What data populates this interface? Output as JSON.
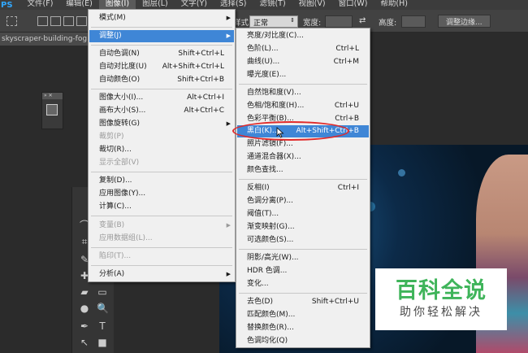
{
  "menubar": {
    "logo": "PS",
    "items": [
      "文件(F)",
      "编辑(E)",
      "图像(I)",
      "图层(L)",
      "文字(Y)",
      "选择(S)",
      "滤镜(T)",
      "视图(V)",
      "窗口(W)",
      "帮助(H)"
    ],
    "active_index": 2
  },
  "options": {
    "style_label": "样式:",
    "style_value": "正常",
    "width_label": "宽度:",
    "height_label": "高度:",
    "refine_button": "调整边缘..."
  },
  "document": {
    "tab_title": "skyscraper-building-fog.jp"
  },
  "image_menu": {
    "items": [
      {
        "label": "模式(M)",
        "shortcut": "",
        "submenu": true,
        "disabled": false,
        "highlighted": false
      },
      {
        "label": "调整(J)",
        "shortcut": "",
        "submenu": true,
        "disabled": false,
        "highlighted": true
      },
      {
        "label": "自动色调(N)",
        "shortcut": "Shift+Ctrl+L",
        "submenu": false,
        "disabled": false,
        "highlighted": false
      },
      {
        "label": "自动对比度(U)",
        "shortcut": "Alt+Shift+Ctrl+L",
        "submenu": false,
        "disabled": false,
        "highlighted": false
      },
      {
        "label": "自动颜色(O)",
        "shortcut": "Shift+Ctrl+B",
        "submenu": false,
        "disabled": false,
        "highlighted": false
      },
      {
        "label": "图像大小(I)...",
        "shortcut": "Alt+Ctrl+I",
        "submenu": false,
        "disabled": false,
        "highlighted": false
      },
      {
        "label": "画布大小(S)...",
        "shortcut": "Alt+Ctrl+C",
        "submenu": false,
        "disabled": false,
        "highlighted": false
      },
      {
        "label": "图像旋转(G)",
        "shortcut": "",
        "submenu": true,
        "disabled": false,
        "highlighted": false
      },
      {
        "label": "裁剪(P)",
        "shortcut": "",
        "submenu": false,
        "disabled": true,
        "highlighted": false
      },
      {
        "label": "裁切(R)...",
        "shortcut": "",
        "submenu": false,
        "disabled": false,
        "highlighted": false
      },
      {
        "label": "显示全部(V)",
        "shortcut": "",
        "submenu": false,
        "disabled": true,
        "highlighted": false
      },
      {
        "label": "复制(D)...",
        "shortcut": "",
        "submenu": false,
        "disabled": false,
        "highlighted": false
      },
      {
        "label": "应用图像(Y)...",
        "shortcut": "",
        "submenu": false,
        "disabled": false,
        "highlighted": false
      },
      {
        "label": "计算(C)...",
        "shortcut": "",
        "submenu": false,
        "disabled": false,
        "highlighted": false
      },
      {
        "label": "变量(B)",
        "shortcut": "",
        "submenu": true,
        "disabled": true,
        "highlighted": false
      },
      {
        "label": "应用数据组(L)...",
        "shortcut": "",
        "submenu": false,
        "disabled": true,
        "highlighted": false
      },
      {
        "label": "陷印(T)...",
        "shortcut": "",
        "submenu": false,
        "disabled": true,
        "highlighted": false
      },
      {
        "label": "分析(A)",
        "shortcut": "",
        "submenu": true,
        "disabled": false,
        "highlighted": false
      }
    ]
  },
  "adjust_menu": {
    "items": [
      {
        "label": "亮度/对比度(C)...",
        "shortcut": "",
        "highlighted": false
      },
      {
        "label": "色阶(L)...",
        "shortcut": "Ctrl+L",
        "highlighted": false
      },
      {
        "label": "曲线(U)...",
        "shortcut": "Ctrl+M",
        "highlighted": false
      },
      {
        "label": "曝光度(E)...",
        "shortcut": "",
        "highlighted": false
      },
      {
        "label": "自然饱和度(V)...",
        "shortcut": "",
        "highlighted": false
      },
      {
        "label": "色相/饱和度(H)...",
        "shortcut": "Ctrl+U",
        "highlighted": false
      },
      {
        "label": "色彩平衡(B)...",
        "shortcut": "Ctrl+B",
        "highlighted": false
      },
      {
        "label": "黑白(K)...",
        "shortcut": "Alt+Shift+Ctrl+B",
        "highlighted": true
      },
      {
        "label": "照片滤镜(F)...",
        "shortcut": "",
        "highlighted": false
      },
      {
        "label": "通道混合器(X)...",
        "shortcut": "",
        "highlighted": false
      },
      {
        "label": "颜色查找...",
        "shortcut": "",
        "highlighted": false
      },
      {
        "label": "反相(I)",
        "shortcut": "Ctrl+I",
        "highlighted": false
      },
      {
        "label": "色调分离(P)...",
        "shortcut": "",
        "highlighted": false
      },
      {
        "label": "阈值(T)...",
        "shortcut": "",
        "highlighted": false
      },
      {
        "label": "渐变映射(G)...",
        "shortcut": "",
        "highlighted": false
      },
      {
        "label": "可选颜色(S)...",
        "shortcut": "",
        "highlighted": false
      },
      {
        "label": "阴影/高光(W)...",
        "shortcut": "",
        "highlighted": false
      },
      {
        "label": "HDR 色调...",
        "shortcut": "",
        "highlighted": false
      },
      {
        "label": "变化...",
        "shortcut": "",
        "highlighted": false
      },
      {
        "label": "去色(D)",
        "shortcut": "Shift+Ctrl+U",
        "highlighted": false
      },
      {
        "label": "匹配颜色(M)...",
        "shortcut": "",
        "highlighted": false
      },
      {
        "label": "替换颜色(R)...",
        "shortcut": "",
        "highlighted": false
      },
      {
        "label": "色调均化(Q)",
        "shortcut": "",
        "highlighted": false
      }
    ]
  },
  "watermark": {
    "main": "百科全说",
    "sub": "助你轻松解决"
  },
  "colors": {
    "highlight": "#3f86d6",
    "annotation": "#e02a2a",
    "watermark_green": "#3fb45a"
  }
}
